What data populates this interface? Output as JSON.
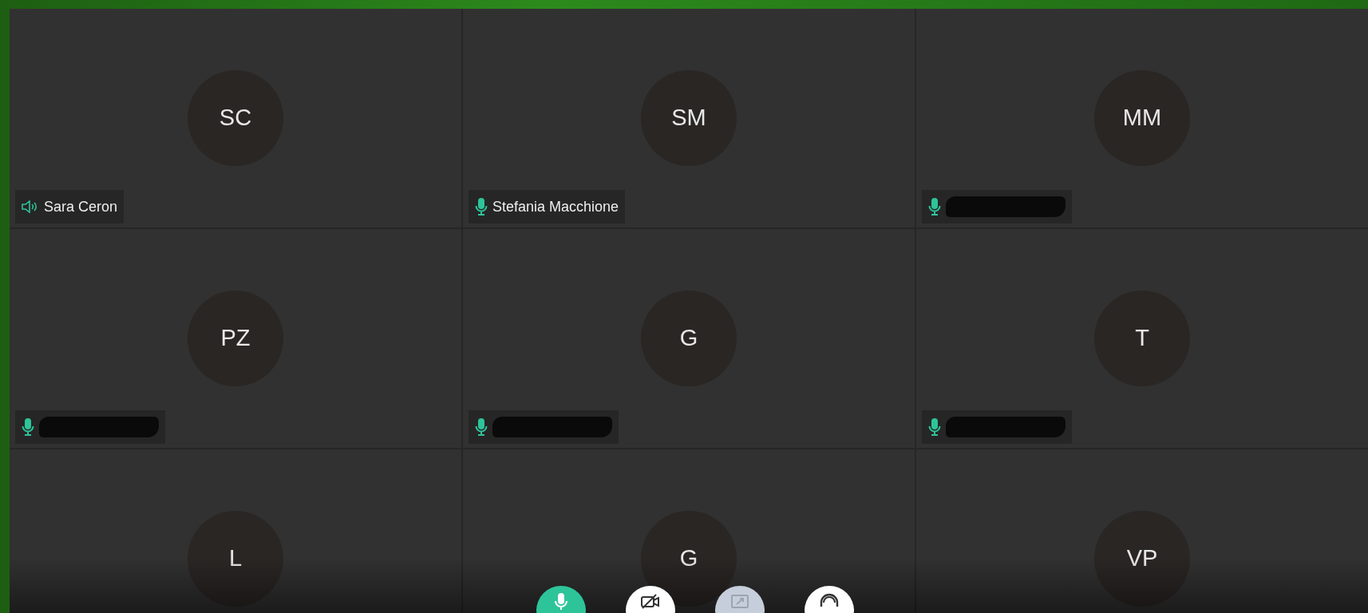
{
  "tiles": [
    {
      "initials": "SC",
      "kind": "speaking",
      "name": "Sara Ceron",
      "name_redacted": false
    },
    {
      "initials": "SM",
      "kind": "mic",
      "name": "Stefania Macchione",
      "name_redacted": false
    },
    {
      "initials": "MM",
      "kind": "mic",
      "name_redacted": true
    },
    {
      "initials": "PZ",
      "kind": "mic",
      "name_redacted": true
    },
    {
      "initials": "G",
      "kind": "mic",
      "name_redacted": true
    },
    {
      "initials": "T",
      "kind": "mic",
      "name_redacted": true
    },
    {
      "initials": "L"
    },
    {
      "initials": "G"
    },
    {
      "initials": "VP"
    }
  ],
  "toolbar": [
    {
      "kind": "microphone",
      "on": true,
      "disabled": false
    },
    {
      "kind": "camera",
      "on": false,
      "disabled": false
    },
    {
      "kind": "share",
      "disabled": true
    },
    {
      "kind": "headset",
      "on": false,
      "disabled": false
    }
  ]
}
